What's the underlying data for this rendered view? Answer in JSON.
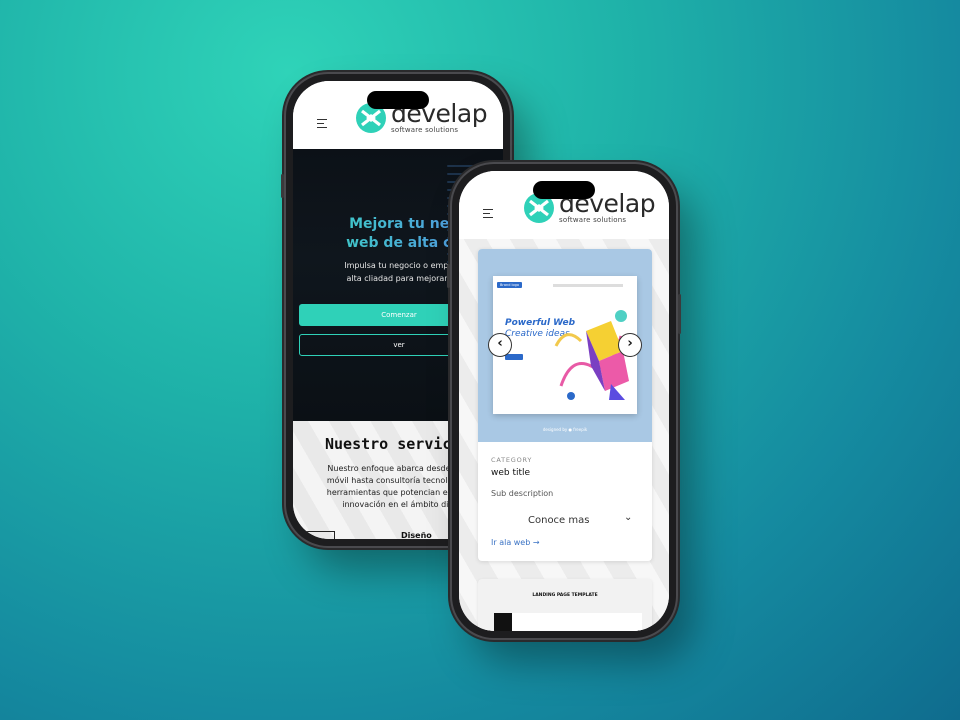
{
  "brand": {
    "name": "develap",
    "tagline": "software solutions",
    "color_primary": "#2fd1b8",
    "color_dark": "#0c1117"
  },
  "phone1": {
    "hero": {
      "title_line1": "Mejora tu negocio.",
      "title_line2": "web de alta calidad",
      "description_line1": "Impulsa tu negocio o empresa con un s",
      "description_line2": "alta cliadad para mejorar tus ventas o",
      "primary_button": "Comenzar",
      "secondary_button": "ver"
    },
    "services": {
      "title": "Nuestro servic",
      "description_lines": [
        "Nuestro enfoque abarca desde desarr",
        "móvil hasta consultoría tecnológica, b",
        "herramientas que potencian el crecim",
        "innovación en el ámbito digita"
      ],
      "first_item": "Diseño"
    }
  },
  "phone2": {
    "card": {
      "preview_heading": "Powerful Web",
      "preview_subheading": "Creative ideas",
      "preview_logo": "Brand logo",
      "preview_credit": "designed by ● freepik",
      "prev_icon": "chevron-left-icon",
      "next_icon": "chevron-right-icon",
      "prev_glyph": "‹",
      "next_glyph": "›",
      "category": "CATEGORY",
      "title": "web title",
      "subtitle": "Sub description",
      "more_label": "Conoce mas",
      "more_chevron": "⌄",
      "link": "Ir ala web  →"
    },
    "card2": {
      "title": "LANDING PAGE TEMPLATE"
    }
  }
}
